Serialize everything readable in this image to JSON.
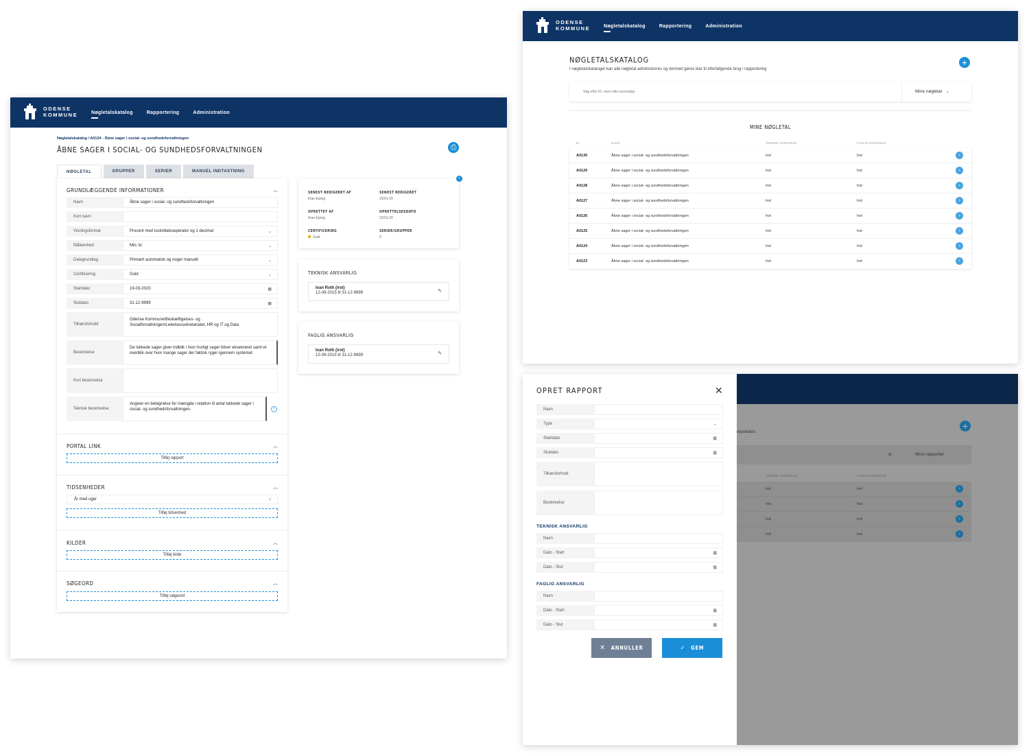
{
  "brand": {
    "line1": "ODENSE",
    "line2": "KOMMUNE"
  },
  "nav": {
    "items": [
      "Nøgletalskatalog",
      "Rapportering",
      "Administration"
    ]
  },
  "detail": {
    "breadcrumb": "Nøgletalskatalog / A0124 - Åbne sager i social- og sundhedsforvaltningen",
    "title": "ÅBNE SAGER I SOCIAL- OG SUNDHEDSFORVALTNINGEN",
    "tabs": [
      "NØGLETAL",
      "GRUPPER",
      "SERIER",
      "MANUEL INDTASTNING"
    ],
    "basic_title": "GRUNDLÆGGENDE INFORMATIONER",
    "fields": [
      {
        "label": "Navn",
        "value": "Åbne sager i social- og sundhedsforvaltningen"
      },
      {
        "label": "Kort navn",
        "value": ""
      },
      {
        "label": "Visningsformat",
        "value": "Procent med tusindtalsseperator og 1 decimal"
      },
      {
        "label": "Måleenhed",
        "value": "Mio. kr."
      },
      {
        "label": "Datagrundlag",
        "value": "Primært automatisk og noget manuelt"
      },
      {
        "label": "Certificering",
        "value": "Guld"
      },
      {
        "label": "Startdato",
        "value": "19-03-2020"
      },
      {
        "label": "Slutdato",
        "value": "31-12-9999"
      },
      {
        "label": "Tilhørsforhold",
        "value": "Odense Kommune\\Beskæftigelses- og Socialforvaltningen\\Ledelsessekretariatet, HR og IT og Data"
      },
      {
        "label": "Beskrivelse",
        "value": "De lukkede sager giver indblik i hvor hurtigt sager bliver eksekveret samt et overblik over hvor mange sager der faktisk ryger igennem systemet."
      },
      {
        "label": "Kort beskrivelse",
        "value": ""
      },
      {
        "label": "Teknisk beskrivelse",
        "value": "Angiver en betegnelse for mængde i relation til antal lukkede sager i social- og sundhedsforvaltningen."
      }
    ],
    "portal_title": "PORTAL LINK",
    "portal_btn": "Tilføj rapport",
    "time_title": "TIDSENHEDER",
    "time_item": "År med uger",
    "time_btn": "Tilføj tidsenhed",
    "sources_title": "KILDER",
    "sources_btn": "Tilføj kilde",
    "keywords_title": "SØGEORD",
    "keywords_btn": "Tilføj søgeord",
    "meta": {
      "last_edited_by_label": "SENEST REDIGERET AF",
      "last_edited_by": "Kian Ejsing",
      "last_edited_label": "SENEST REDIGERET",
      "last_edited": "23/01-20",
      "created_by_label": "OPRETTET AF",
      "created_by": "Kian Ejsing",
      "created_label": "OPRETTELSESDATO",
      "created": "22/01-20",
      "cert_label": "CERTIFICERING",
      "cert": "Guld",
      "series_label": "SERIER/GRUPPER",
      "series": "0"
    },
    "tech_title": "TEKNISK ANSVARLIG",
    "tech_name": "Ivan Roth (irot)",
    "tech_dates": "12-08-2015 til 31-12-9999",
    "prof_title": "FAGLIG ANSVARLIG",
    "prof_name": "Ivan Roth (irot)",
    "prof_dates": "12-08-2015 til 31-12-9999"
  },
  "catalog": {
    "title": "NØGLETALSKATALOG",
    "subtitle": "I nøgletalskataloget kan alle nøgletal administreres og dermed gøres klar til efterfølgende brug i rapportering",
    "search_placeholder": "Søg efter ID, navn eller ansvarlige",
    "filter": "Mine nøgletal",
    "list_title": "MINE NØGLETAL",
    "columns": [
      "ID",
      "NAVN",
      "TEKNISK ANSVARLIG",
      "FAGLIG ANSVARLIG"
    ],
    "rows": [
      {
        "id": "A0130",
        "name": "Åbne sager i social- og sundhedsforvaltningen",
        "tech": "Irot",
        "prof": "Irot"
      },
      {
        "id": "A0129",
        "name": "Åbne sager i social- og sundhedsforvaltningen",
        "tech": "Irot",
        "prof": "Irot"
      },
      {
        "id": "A0128",
        "name": "Åbne sager i social- og sundhedsforvaltningen",
        "tech": "Irot",
        "prof": "Irot"
      },
      {
        "id": "A0127",
        "name": "Åbne sager i social- og sundhedsforvaltningen",
        "tech": "Irot",
        "prof": "Irot"
      },
      {
        "id": "A0126",
        "name": "Åbne sager i social- og sundhedsforvaltningen",
        "tech": "Irot",
        "prof": "Irot"
      },
      {
        "id": "A0125",
        "name": "Åbne sager i social- og sundhedsforvaltningen",
        "tech": "Irot",
        "prof": "Irot"
      },
      {
        "id": "A0124",
        "name": "Åbne sager i social- og sundhedsforvaltningen",
        "tech": "Irot",
        "prof": "Irot"
      },
      {
        "id": "A0123",
        "name": "Åbne sager i social- og sundhedsforvaltningen",
        "tech": "Irot",
        "prof": "Irot"
      }
    ]
  },
  "modal": {
    "title": "OPRET RAPPORT",
    "fields": [
      "Navn",
      "Type",
      "Startdato",
      "Slutdato",
      "Tilhørsforhold",
      "Beskrivelse"
    ],
    "tech_title": "TEKNISK ANSVARLIG",
    "tech_fields": [
      "Navn",
      "Dato - Start",
      "Dato - Slut"
    ],
    "prof_title": "FAGLIG ANSVARLIG",
    "prof_fields": [
      "Navn",
      "Dato - Start",
      "Dato - Slut"
    ],
    "cancel": "ANNULLER",
    "save": "GEM",
    "bg_text": "erportalen.",
    "bg_filter": "Mine rapporter",
    "bg_columns": [
      "TEKNISK ANSVARLIG",
      "FAGLIG ANSVARLIG"
    ],
    "bg_rows": [
      {
        "tech": "Irot",
        "prof": "Irot"
      },
      {
        "tech": "Irot",
        "prof": "Irot"
      },
      {
        "tech": "Irot",
        "prof": "Irot"
      },
      {
        "tech": "Irot",
        "prof": "Irot"
      }
    ]
  },
  "colors": {
    "navy": "#0e3466",
    "accent": "#1a8ed6",
    "gold": "#e0a800",
    "cancel_btn": "#6f7f96"
  }
}
